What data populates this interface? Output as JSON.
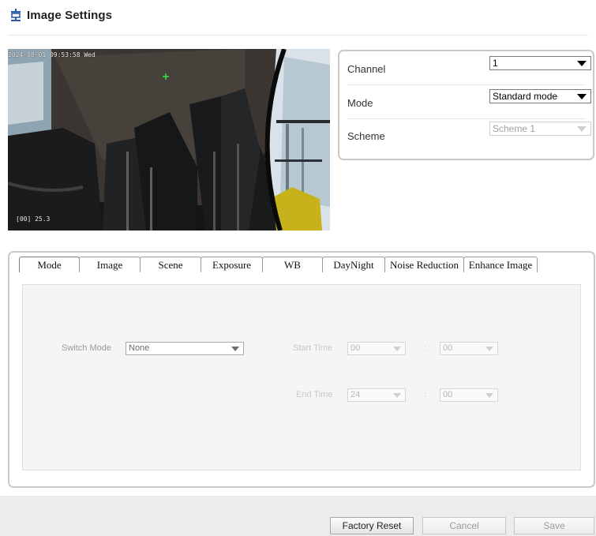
{
  "header": {
    "icon": "settings-image-icon",
    "title": "Image Settings"
  },
  "video": {
    "osd_time": "2024-08-01 09:53:58 Wed",
    "osd_name": "[00] 25.3"
  },
  "panel": {
    "channel": {
      "label": "Channel",
      "value": "1"
    },
    "mode": {
      "label": "Mode",
      "value": "Standard mode"
    },
    "scheme": {
      "label": "Scheme",
      "value": "Scheme 1"
    }
  },
  "tabs": [
    {
      "label": "Mode",
      "active": true
    },
    {
      "label": "Image"
    },
    {
      "label": "Scene"
    },
    {
      "label": "Exposure"
    },
    {
      "label": "WB"
    },
    {
      "label": "DayNight"
    },
    {
      "label": "Noise Reduction"
    },
    {
      "label": "Enhance Image"
    }
  ],
  "mode_tab": {
    "switch_mode": {
      "label": "Switch Mode",
      "value": "None"
    },
    "start_time": {
      "label": "Start Time",
      "hour": "00",
      "minute": "00",
      "sep": ":"
    },
    "end_time": {
      "label": "End Time",
      "hour": "24",
      "minute": "00",
      "sep": ":"
    }
  },
  "buttons": {
    "factory_reset": "Factory Reset",
    "cancel": "Cancel",
    "save": "Save"
  },
  "colors": {
    "panel_border": "#c9c9c9",
    "content_bg": "#f5f5f5",
    "bottom_bar": "#ececec"
  }
}
